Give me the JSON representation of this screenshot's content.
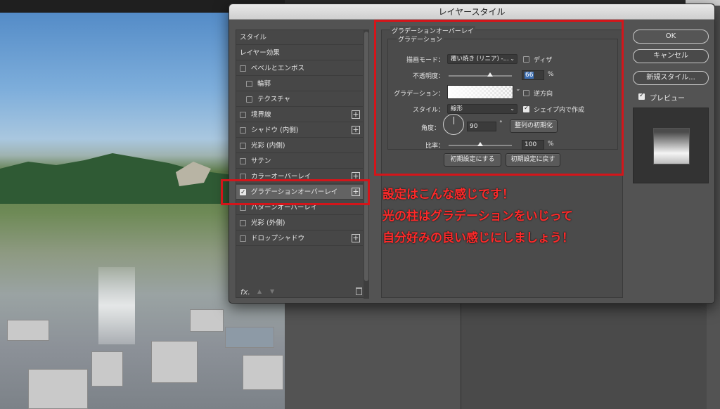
{
  "dialog": {
    "title": "レイヤースタイル"
  },
  "left_panel": {
    "items": [
      {
        "label": "スタイル",
        "checkbox": false,
        "plus": false,
        "selected": false
      },
      {
        "label": "レイヤー効果",
        "checkbox": false,
        "plus": false,
        "selected": false
      },
      {
        "label": "ベベルとエンボス",
        "checkbox": true,
        "plus": false,
        "selected": false
      },
      {
        "label": "輪郭",
        "checkbox": true,
        "plus": false,
        "selected": false,
        "indent": true
      },
      {
        "label": "テクスチャ",
        "checkbox": true,
        "plus": false,
        "selected": false,
        "indent": true
      },
      {
        "label": "境界線",
        "checkbox": true,
        "plus": true,
        "selected": false
      },
      {
        "label": "シャドウ (内側)",
        "checkbox": true,
        "plus": true,
        "selected": false
      },
      {
        "label": "光彩 (内側)",
        "checkbox": true,
        "plus": false,
        "selected": false
      },
      {
        "label": "サテン",
        "checkbox": true,
        "plus": false,
        "selected": false
      },
      {
        "label": "カラーオーバーレイ",
        "checkbox": true,
        "plus": true,
        "selected": false
      },
      {
        "label": "グラデーションオーバーレイ",
        "checkbox": true,
        "plus": true,
        "selected": true,
        "checked": true
      },
      {
        "label": "パターンオーバーレイ",
        "checkbox": true,
        "plus": false,
        "selected": false
      },
      {
        "label": "光彩 (外側)",
        "checkbox": true,
        "plus": false,
        "selected": false
      },
      {
        "label": "ドロップシャドウ",
        "checkbox": true,
        "plus": true,
        "selected": false
      }
    ],
    "footer": {
      "fx": "fx.",
      "up": "▲",
      "down": "▼",
      "trash": "🗑"
    }
  },
  "gradient_overlay": {
    "section_title": "グラデーションオーバーレイ",
    "group_title": "グラデーション",
    "blend_mode_label": "描画モード：",
    "blend_mode_value": "覆い焼き (リニア) -...",
    "dither_label": "ディザ",
    "opacity_label": "不透明度：",
    "opacity_value": "66",
    "opacity_unit": "%",
    "opacity_fraction": 0.66,
    "gradient_label": "グラデーション：",
    "reverse_label": "逆方向",
    "style_label": "スタイル：",
    "style_value": "線形",
    "align_label": "シェイプ内で作成",
    "angle_label": "角度：",
    "angle_value": "90",
    "angle_unit": "°",
    "reset_align_button": "整列の初期化",
    "scale_label": "比率：",
    "scale_value": "100",
    "scale_unit": "%",
    "scale_fraction": 0.5,
    "make_default_button": "初期設定にする",
    "reset_default_button": "初期設定に戻す"
  },
  "right_panel": {
    "ok_button": "OK",
    "cancel_button": "キャンセル",
    "new_style_button": "新規スタイル...",
    "preview_label": "プレビュー"
  },
  "annotation": {
    "lines": [
      "設定はこんな感じです！",
      "光の柱はグラデーションをいじって",
      "自分好みの良い感じにしましょう！"
    ],
    "color": "#d4151a"
  }
}
